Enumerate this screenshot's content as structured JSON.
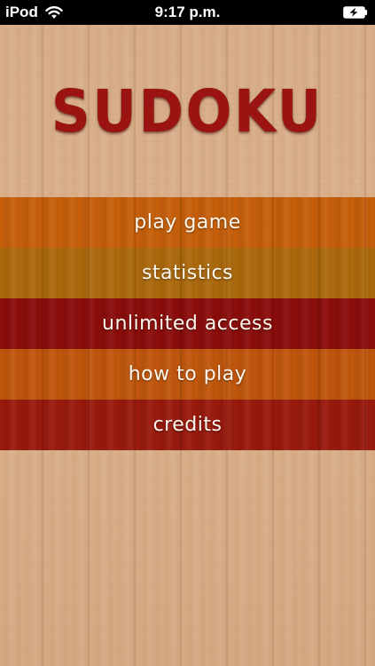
{
  "status_bar": {
    "carrier": "iPod",
    "time": "9:17 p.m.",
    "wifi_icon": "wifi-icon",
    "battery_icon": "battery-charging-icon"
  },
  "app": {
    "title": "SUDOKU",
    "title_color": "#9b1411"
  },
  "menu": {
    "items": [
      {
        "label": "play game",
        "color": "#c8600a"
      },
      {
        "label": "statistics",
        "color": "#ad6a0c"
      },
      {
        "label": "unlimited access",
        "color": "#8c0d0b"
      },
      {
        "label": "how to play",
        "color": "#c2570c"
      },
      {
        "label": "credits",
        "color": "#9a1a0d"
      }
    ]
  }
}
